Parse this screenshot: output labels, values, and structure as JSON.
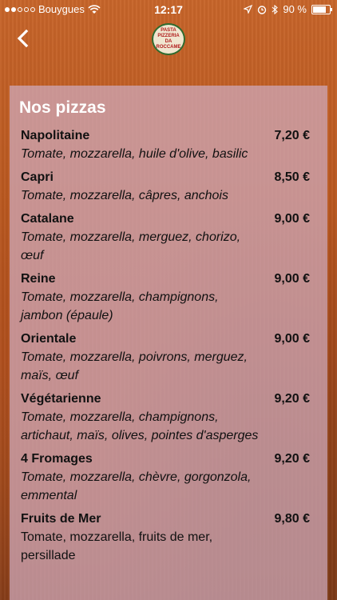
{
  "status_bar": {
    "carrier": "Bouygues",
    "time": "12:17",
    "battery": "90 %",
    "battery_level": 0.9,
    "signal_bars_filled": 2,
    "signal_bars_total": 5
  },
  "nav": {
    "logo_lines": [
      "PASTA",
      "PIZZERIA",
      "DA",
      "ROCCAME"
    ]
  },
  "menu": {
    "title": "Nos pizzas",
    "items": [
      {
        "name": "Napolitaine",
        "price": "7,20 €",
        "description": "Tomate, mozzarella, huile d'olive, basilic"
      },
      {
        "name": "Capri",
        "price": "8,50 €",
        "description": "Tomate, mozzarella, câpres, anchois"
      },
      {
        "name": "Catalane",
        "price": "9,00 €",
        "description": "Tomate, mozzarella, merguez, chorizo, œuf"
      },
      {
        "name": "Reine",
        "price": "9,00 €",
        "description": "Tomate, mozzarella, champignons, jambon (épaule)"
      },
      {
        "name": "Orientale",
        "price": "9,00 €",
        "description": "Tomate, mozzarella, poivrons, merguez, maïs, œuf"
      },
      {
        "name": "Végétarienne",
        "price": "9,20 €",
        "description": "Tomate, mozzarella, champignons, artichaut, maïs, olives, pointes d'asperges"
      },
      {
        "name": "4 Fromages",
        "price": "9,20 €",
        "description": "Tomate, mozzarella, chèvre, gorgonzola, emmental"
      },
      {
        "name": "Fruits de Mer",
        "price": "9,80 €",
        "description": "Tomate, mozzarella, fruits de mer, persillade"
      }
    ]
  },
  "colors": {
    "panel_overlay": "#ceaabe",
    "background_orange": "#c7652a",
    "logo_green": "#2f6b2f",
    "logo_red": "#b01c1c"
  },
  "icons": {
    "back": "chevron-left-icon",
    "wifi": "wifi-icon",
    "location": "location-arrow-icon",
    "alarm": "alarm-clock-icon",
    "bluetooth": "bluetooth-icon",
    "battery": "battery-icon"
  }
}
